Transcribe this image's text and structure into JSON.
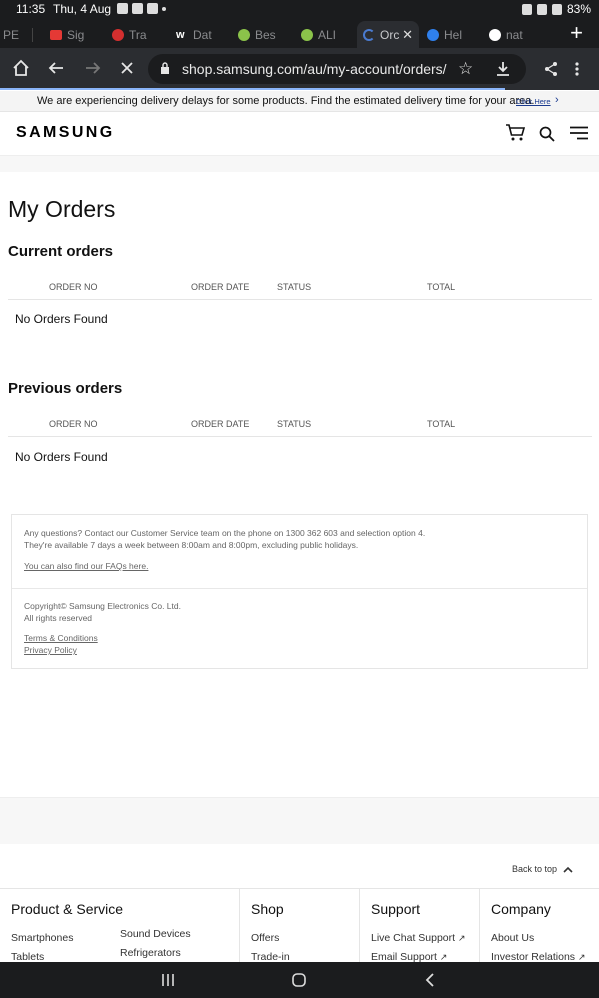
{
  "status_bar": {
    "time": "11:35",
    "date": "Thu, 4 Aug",
    "battery": "83%"
  },
  "tabs": [
    {
      "label": "PE",
      "favicon_color": "#5a5a5a"
    },
    {
      "label": "Sig",
      "favicon_color": "#e53935"
    },
    {
      "label": "Tra",
      "favicon_color": "#d32f2f"
    },
    {
      "label": "Dat",
      "favicon_color": "#ffffff"
    },
    {
      "label": "Bes",
      "favicon_color": "#8bc34a"
    },
    {
      "label": "ALI",
      "favicon_color": "#8bc34a"
    },
    {
      "label": "Orc",
      "favicon_color": "#4a7bd0",
      "active": true
    },
    {
      "label": "Hel",
      "favicon_color": "#2f80ed"
    },
    {
      "label": "nat",
      "favicon_color": "#ffffff"
    }
  ],
  "toolbar": {
    "url": "shop.samsung.com/au/my-account/orders/"
  },
  "banner": {
    "message": "We are experiencing delivery delays for some products. Find the estimated delivery time for your area.",
    "link": "Click Here"
  },
  "header": {
    "logo": "SAMSUNG"
  },
  "main": {
    "title": "My Orders",
    "current": {
      "title": "Current orders",
      "columns": [
        "ORDER NO",
        "ORDER DATE",
        "STATUS",
        "TOTAL"
      ],
      "empty": "No Orders Found"
    },
    "previous": {
      "title": "Previous orders",
      "columns": [
        "ORDER NO",
        "ORDER DATE",
        "STATUS",
        "TOTAL"
      ],
      "empty": "No Orders Found"
    }
  },
  "info": {
    "line1": "Any questions? Contact our Customer Service team on the phone on 1300 362 603 and selection option 4.",
    "line2": "They're available 7 days a week between 8:00am and 8:00pm, excluding public holidays.",
    "faq_link": "You can also find our FAQs here.",
    "copyright": "Copyright© Samsung Electronics Co. Ltd.",
    "rights": "All rights reserved",
    "terms": "Terms & Conditions",
    "privacy": "Privacy Policy"
  },
  "footer": {
    "back_to_top": "Back to top",
    "columns": [
      {
        "title": "Product & Service",
        "links": [
          "Smartphones",
          "Tablets",
          "Sound Devices",
          "Refrigerators"
        ]
      },
      {
        "title": "Shop",
        "links": [
          "Offers",
          "Trade-in"
        ]
      },
      {
        "title": "Support",
        "links": [
          "Live Chat Support",
          "Email Support"
        ]
      },
      {
        "title": "Company",
        "links": [
          "About Us",
          "Investor Relations"
        ]
      }
    ]
  }
}
